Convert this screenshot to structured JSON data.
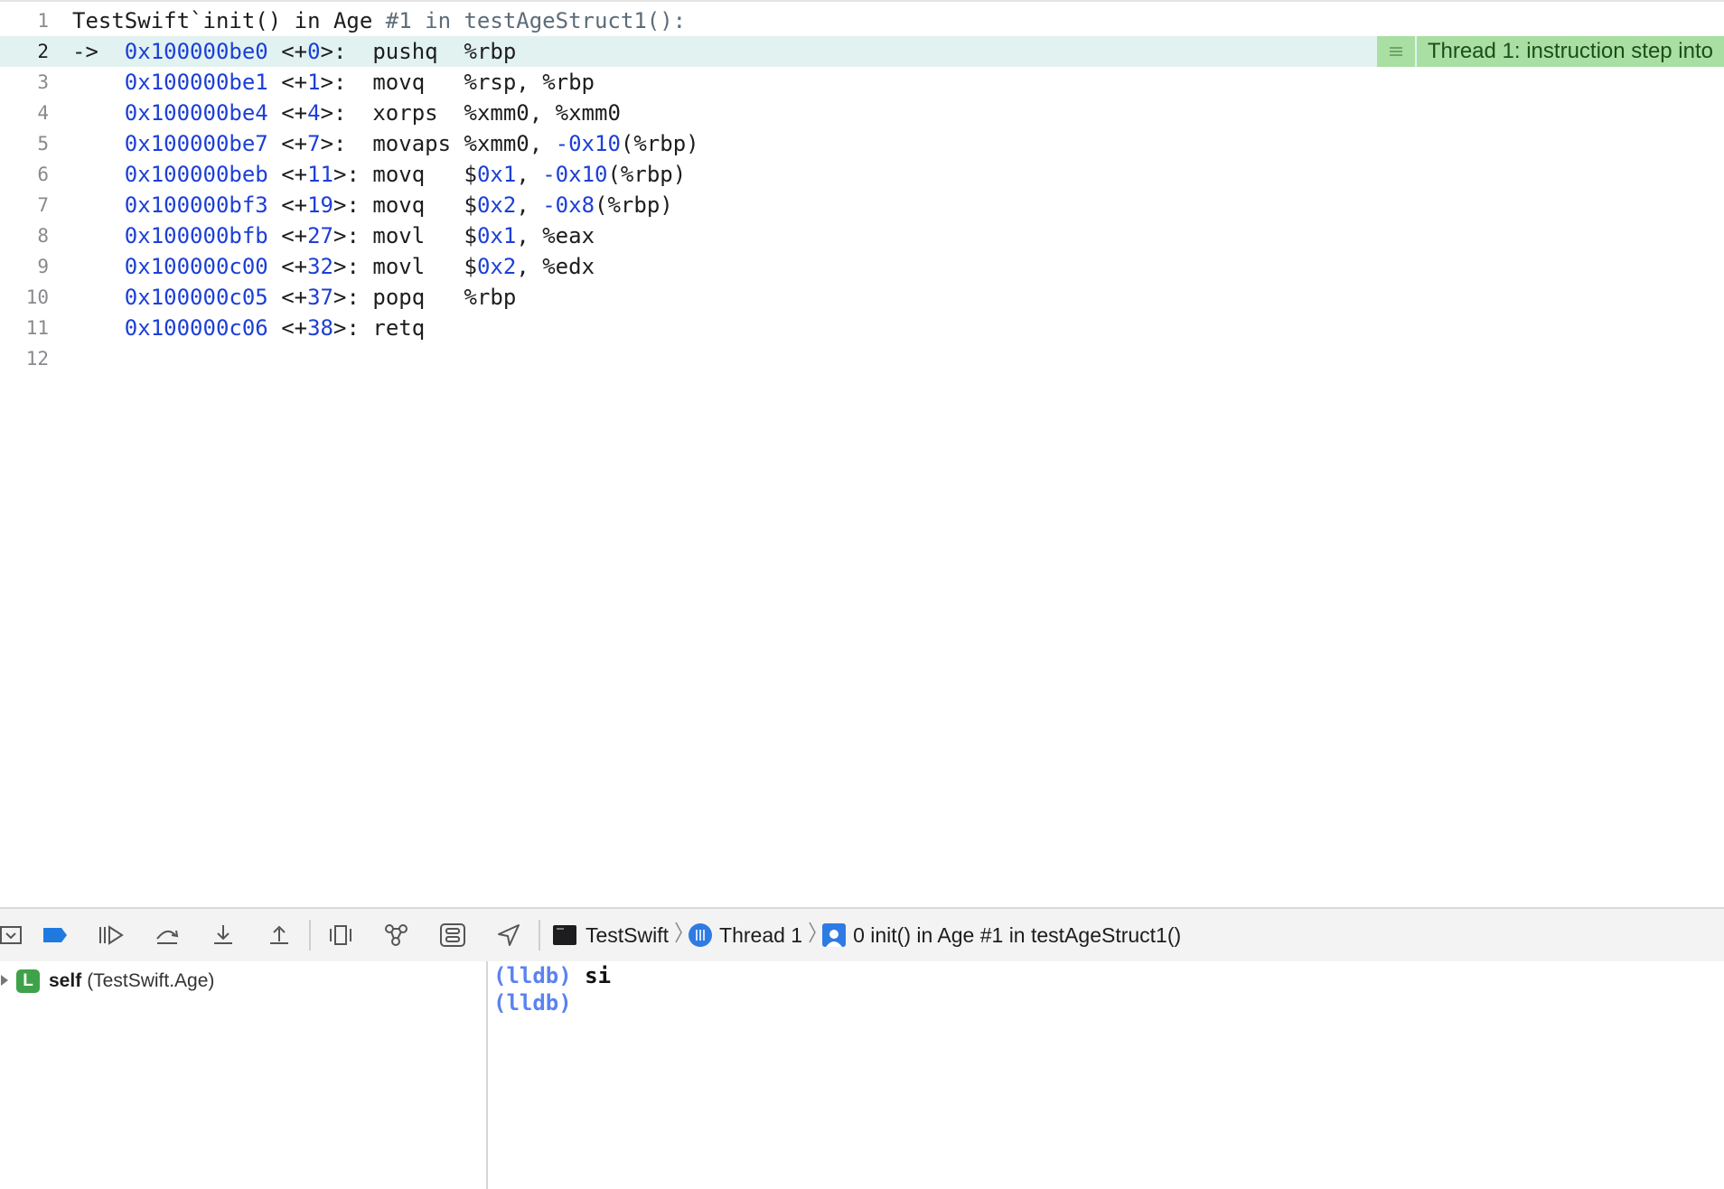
{
  "editor": {
    "lines": [
      {
        "n": "1",
        "parts": [
          [
            "plain",
            "TestSwift`init() in Age "
          ],
          [
            "cmt",
            "#1 in testAgeStruct1():"
          ]
        ]
      },
      {
        "n": "2",
        "current": true,
        "parts": [
          [
            "plain",
            "->  "
          ],
          [
            "addr",
            "0x100000be0"
          ],
          [
            "plain",
            " <+"
          ],
          [
            "num",
            "0"
          ],
          [
            "plain",
            ">:  pushq  %rbp"
          ]
        ]
      },
      {
        "n": "3",
        "parts": [
          [
            "plain",
            "    "
          ],
          [
            "addr",
            "0x100000be1"
          ],
          [
            "plain",
            " <+"
          ],
          [
            "num",
            "1"
          ],
          [
            "plain",
            ">:  movq   %rsp, %rbp"
          ]
        ]
      },
      {
        "n": "4",
        "parts": [
          [
            "plain",
            "    "
          ],
          [
            "addr",
            "0x100000be4"
          ],
          [
            "plain",
            " <+"
          ],
          [
            "num",
            "4"
          ],
          [
            "plain",
            ">:  xorps  %xmm0, %xmm0"
          ]
        ]
      },
      {
        "n": "5",
        "parts": [
          [
            "plain",
            "    "
          ],
          [
            "addr",
            "0x100000be7"
          ],
          [
            "plain",
            " <+"
          ],
          [
            "num",
            "7"
          ],
          [
            "plain",
            ">:  movaps %xmm0, "
          ],
          [
            "num",
            "-0x10"
          ],
          [
            "plain",
            "(%rbp)"
          ]
        ]
      },
      {
        "n": "6",
        "parts": [
          [
            "plain",
            "    "
          ],
          [
            "addr",
            "0x100000beb"
          ],
          [
            "plain",
            " <+"
          ],
          [
            "num",
            "11"
          ],
          [
            "plain",
            ">: movq   $"
          ],
          [
            "num",
            "0x1"
          ],
          [
            "plain",
            ", "
          ],
          [
            "num",
            "-0x10"
          ],
          [
            "plain",
            "(%rbp)"
          ]
        ]
      },
      {
        "n": "7",
        "parts": [
          [
            "plain",
            "    "
          ],
          [
            "addr",
            "0x100000bf3"
          ],
          [
            "plain",
            " <+"
          ],
          [
            "num",
            "19"
          ],
          [
            "plain",
            ">: movq   $"
          ],
          [
            "num",
            "0x2"
          ],
          [
            "plain",
            ", "
          ],
          [
            "num",
            "-0x8"
          ],
          [
            "plain",
            "(%rbp)"
          ]
        ]
      },
      {
        "n": "8",
        "parts": [
          [
            "plain",
            "    "
          ],
          [
            "addr",
            "0x100000bfb"
          ],
          [
            "plain",
            " <+"
          ],
          [
            "num",
            "27"
          ],
          [
            "plain",
            ">: movl   $"
          ],
          [
            "num",
            "0x1"
          ],
          [
            "plain",
            ", %eax"
          ]
        ]
      },
      {
        "n": "9",
        "parts": [
          [
            "plain",
            "    "
          ],
          [
            "addr",
            "0x100000c00"
          ],
          [
            "plain",
            " <+"
          ],
          [
            "num",
            "32"
          ],
          [
            "plain",
            ">: movl   $"
          ],
          [
            "num",
            "0x2"
          ],
          [
            "plain",
            ", %edx"
          ]
        ]
      },
      {
        "n": "10",
        "parts": [
          [
            "plain",
            "    "
          ],
          [
            "addr",
            "0x100000c05"
          ],
          [
            "plain",
            " <+"
          ],
          [
            "num",
            "37"
          ],
          [
            "plain",
            ">: popq   %rbp"
          ]
        ]
      },
      {
        "n": "11",
        "parts": [
          [
            "plain",
            "    "
          ],
          [
            "addr",
            "0x100000c06"
          ],
          [
            "plain",
            " <+"
          ],
          [
            "num",
            "38"
          ],
          [
            "plain",
            ">: retq"
          ]
        ]
      },
      {
        "n": "12",
        "parts": []
      }
    ],
    "annotation": "Thread 1: instruction step into"
  },
  "debugbar": {
    "process": "TestSwift",
    "thread": "Thread 1",
    "frame": "0 init() in Age #1 in testAgeStruct1()"
  },
  "variables": {
    "badge": "L",
    "name": "self",
    "type": "(TestSwift.Age)"
  },
  "console": {
    "lines": [
      {
        "prompt": "(lldb)",
        "cmd": " si"
      },
      {
        "prompt": "(lldb)",
        "cmd": ""
      }
    ]
  },
  "colors": {
    "accent": "#1c3fd6",
    "current_line": "#e2f2f1",
    "annotation": "#a9dfa2",
    "prompt": "#5b82f0"
  }
}
